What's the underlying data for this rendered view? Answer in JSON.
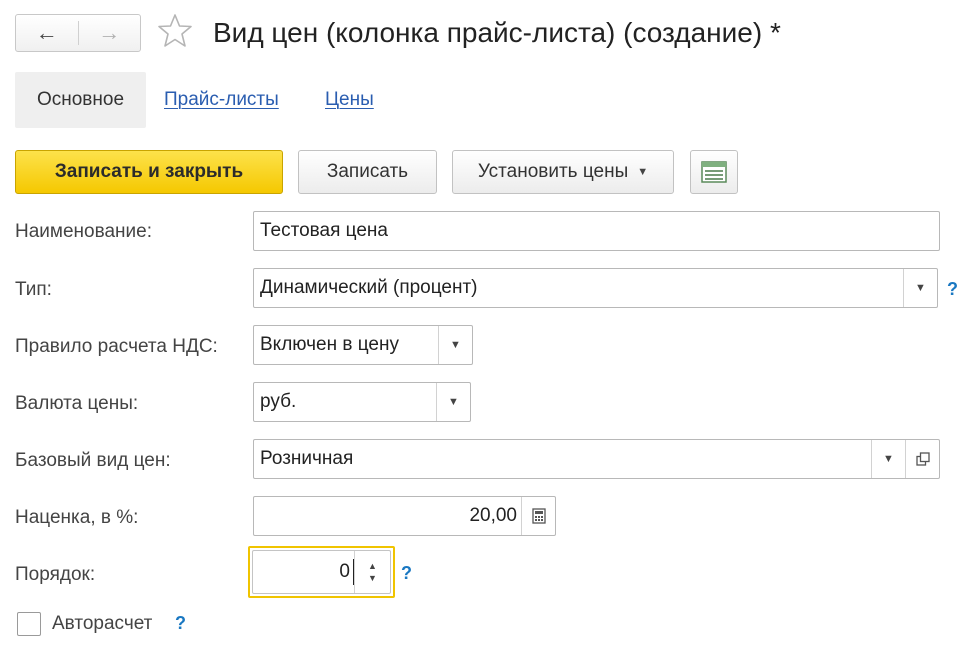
{
  "header": {
    "back_icon": "←",
    "forward_icon": "→",
    "favorite_icon": "star-outline",
    "title": "Вид цен (колонка прайс-листа) (создание) *"
  },
  "tabs": [
    {
      "label": "Основное",
      "active": true
    },
    {
      "label": "Прайс-листы",
      "active": false
    },
    {
      "label": "Цены",
      "active": false
    }
  ],
  "toolbar": {
    "save_close_label": "Записать и закрыть",
    "save_label": "Записать",
    "set_prices_label": "Установить цены",
    "table_icon": "table-settings-icon"
  },
  "form": {
    "name_label": "Наименование:",
    "name_value": "Тестовая цена",
    "type_label": "Тип:",
    "type_value": "Динамический (процент)",
    "vat_label": "Правило расчета НДС:",
    "vat_value": "Включен в цену",
    "currency_label": "Валюта цены:",
    "currency_value": "руб.",
    "base_label": "Базовый вид цен:",
    "base_value": "Розничная",
    "markup_label": "Наценка, в %:",
    "markup_value": "20,00",
    "order_label": "Порядок:",
    "order_value": "0",
    "autocalc_label": "Авторасчет",
    "autocalc_checked": false,
    "help_symbol": "?"
  },
  "colors": {
    "primary_button": "#f5c800",
    "link": "#2a5db0",
    "help": "#1a78c2",
    "focus_border": "#f0c400"
  }
}
